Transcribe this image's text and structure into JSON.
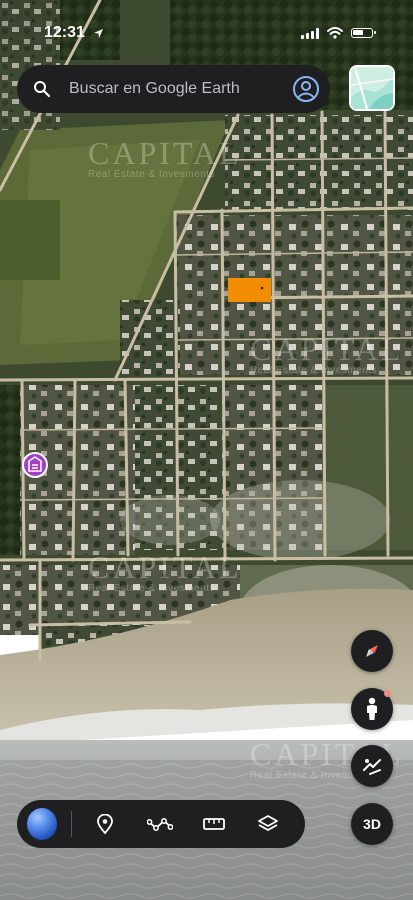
{
  "status_bar": {
    "time": "12:31"
  },
  "search": {
    "placeholder": "Buscar en Google Earth"
  },
  "watermark": {
    "brand": "CAPITAL",
    "tagline": "Real Estate & Invesments"
  },
  "controls": {
    "three_d_label": "3D"
  },
  "colors": {
    "panel": "#1f1f22",
    "highlight": "#f28c00",
    "place_marker": "#a340c7"
  },
  "icons": [
    "search-icon",
    "account-icon",
    "compass-icon",
    "pegman-icon",
    "tilt-icon",
    "globe-icon",
    "place-pin-icon",
    "path-icon",
    "ruler-icon",
    "layers-icon"
  ]
}
